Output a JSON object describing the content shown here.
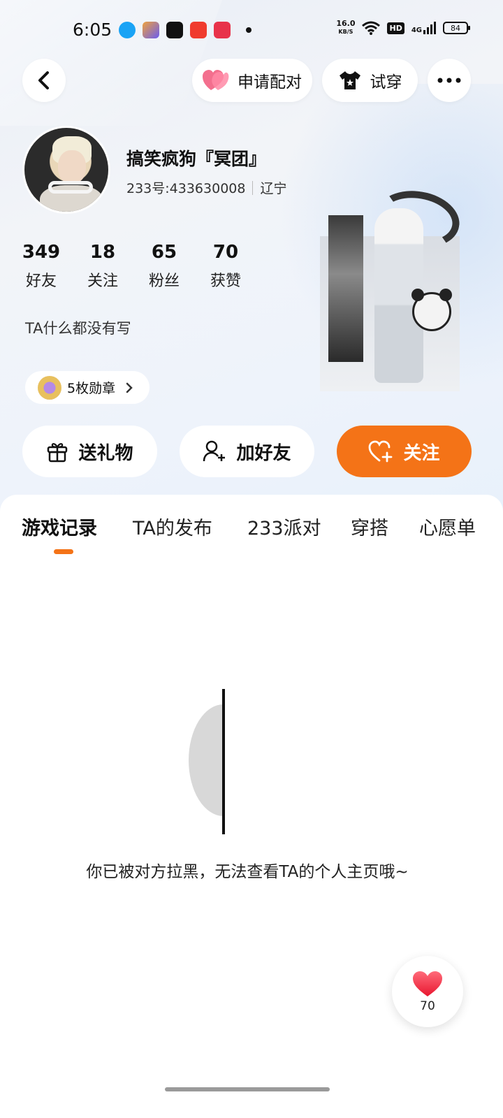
{
  "status_bar": {
    "time": "6:05",
    "net_speed_value": "16.0",
    "net_speed_unit": "KB/S",
    "hd_label": "HD",
    "signal_label": "4G",
    "battery": "84",
    "app_icon_colors": [
      "#1aa3f5",
      "#6a5cf0",
      "#111111",
      "#f03c2e",
      "#e8334a"
    ]
  },
  "header": {
    "pair_label": "申请配对",
    "tryon_label": "试穿"
  },
  "profile": {
    "username": "搞笑疯狗『冥团』",
    "uid": "233号:433630008",
    "location": "辽宁",
    "stats": [
      {
        "value": "349",
        "label": "好友"
      },
      {
        "value": "18",
        "label": "关注"
      },
      {
        "value": "65",
        "label": "粉丝"
      },
      {
        "value": "70",
        "label": "获赞"
      }
    ],
    "bio": "TA什么都没有写",
    "badges": "5枚勋章"
  },
  "actions": {
    "gift": "送礼物",
    "add_friend": "加好友",
    "follow": "关注",
    "accent_color": "#f47317"
  },
  "tabs": [
    "游戏记录",
    "TA的发布",
    "233派对",
    "穿搭",
    "心愿单"
  ],
  "content": {
    "blocked_message": "你已被对方拉黑，无法查看TA的个人主页哦~"
  },
  "like_fab": {
    "count": "70"
  }
}
